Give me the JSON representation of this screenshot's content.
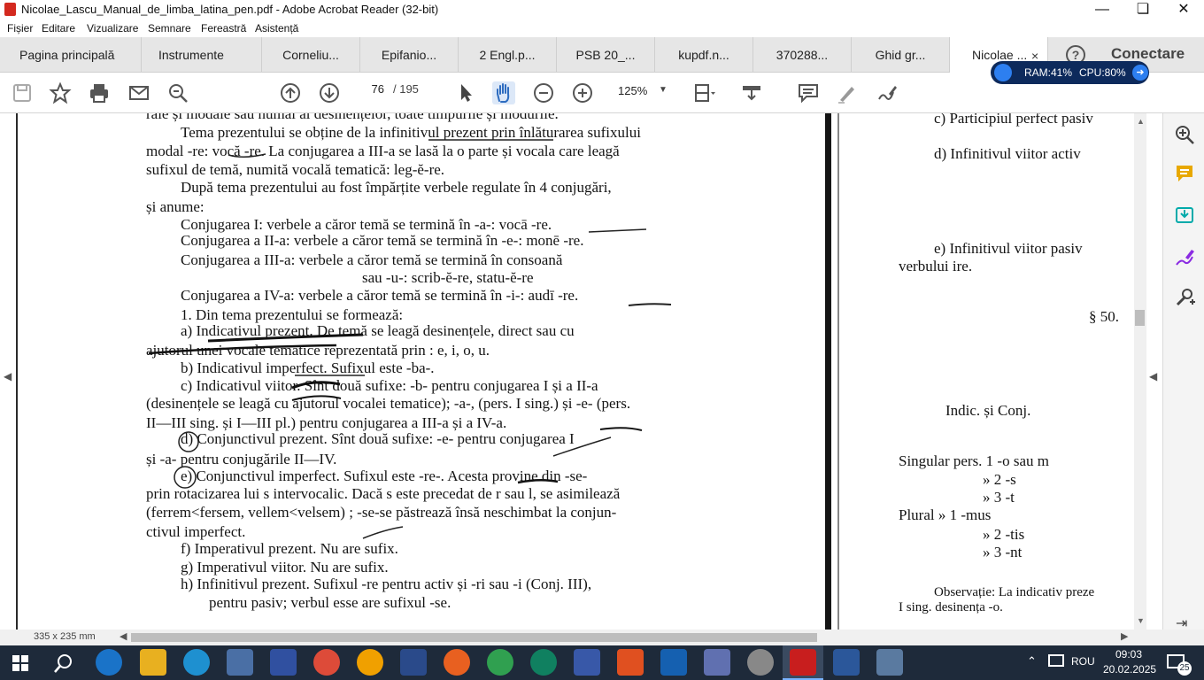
{
  "window": {
    "title": "Nicolae_Lascu_Manual_de_limba_latina_pen.pdf - Adobe Acrobat Reader (32-bit)"
  },
  "menu": [
    "Fișier",
    "Editare",
    "Vizualizare",
    "Semnare",
    "Fereastră",
    "Asistență"
  ],
  "tabs": {
    "home": "Pagina principală",
    "tools": "Instrumente",
    "docs": [
      "Corneliu...",
      "Epifanio...",
      "2 Engl.p...",
      "PSB 20_...",
      "kupdf.n...",
      "370288...",
      "Ghid gr...",
      "Nicolae ..."
    ],
    "connect": "Conectare",
    "help_glyph": "?",
    "close_glyph": "×"
  },
  "toolbar": {
    "page_current": "76",
    "page_total": "/ 195",
    "zoom": "125%"
  },
  "perf": {
    "ram": "RAM:41%",
    "cpu": "CPU:80%"
  },
  "left_page": {
    "lines": [
      "rale și modale sau numai al desinențelor, toate timpurile și modurile.",
      "Tema prezentului se obține de la infinitivul prezent prin înlăturarea sufixului",
      "modal -re: vocă -re. La conjugarea a III-a se lasă la o parte și vocala care leagă",
      "sufixul de temă, numită vocală tematică: leg-ĕ-re.",
      "După tema prezentului au fost împărțite verbele regulate în 4 conjugări,",
      "și anume:",
      "Conjugarea I: verbele a căror temă se termină în -a-: vocā -re.",
      "Conjugarea a II-a: verbele a căror temă se termină în -e-: monē -re.",
      "Conjugarea a III-a: verbele a căror temă se termină în consoană",
      "sau -u-: scrib-ĕ-re, statu-ĕ-re",
      "Conjugarea a IV-a: verbele a căror temă se termină în -i-: audī -re.",
      "1. Din tema prezentului se formează:",
      "a) Indicativul prezent. De temă se leagă desinențele, direct sau cu",
      "ajutorul unei vocale tematice reprezentată prin : e, i, o, u.",
      "b) Indicativul imperfect. Sufixul este -ba-.",
      "c) Indicativul viitor. Sînt două sufixe: -b- pentru conjugarea I și a II-a",
      "(desinențele se leagă cu ajutorul vocalei tematice); -a-, (pers. I sing.) și -e- (pers.",
      "II—III sing. și I—III pl.) pentru conjugarea a III-a și a IV-a.",
      "d) Conjunctivul prezent. Sînt două sufixe: -e- pentru conjugarea I",
      "și -a- pentru conjugările II—IV.",
      "e) Conjunctivul imperfect. Sufixul este -re-. Acesta provine din -se-",
      "prin rotacizarea lui s intervocalic. Dacă s este precedat de r sau l, se asimilează",
      "(ferrem<fersem, vellem<velsem) ; -se-se păstrează însă neschimbat la conjun-",
      "ctivul imperfect.",
      "f) Imperativul prezent. Nu are sufix.",
      "g) Imperativul viitor. Nu are sufix.",
      "h) Infinitivul prezent. Sufixul -re pentru activ și -ri sau -i (Conj. III),",
      "pentru pasiv; verbul esse are sufixul -se."
    ]
  },
  "right_page": {
    "lines": [
      "c) Participiul perfect pasiv",
      "d) Infinitivul viitor activ",
      "e) Infinitivul viitor pasiv",
      "verbului ire.",
      "§ 50.",
      "Indic. și Conj.",
      "Singular pers. 1 -o sau m",
      "»   2 -s",
      "»   3 -t",
      "Plural      »   1 -mus",
      "»   2 -tis",
      "»   3 -nt",
      "Observație: La indicativ preze",
      "I sing. desinența -o."
    ]
  },
  "status": {
    "page_size": "335 x 235 mm"
  },
  "tray": {
    "lang": "ROU",
    "time": "09:03",
    "date": "20.02.2025",
    "notif": "25"
  }
}
